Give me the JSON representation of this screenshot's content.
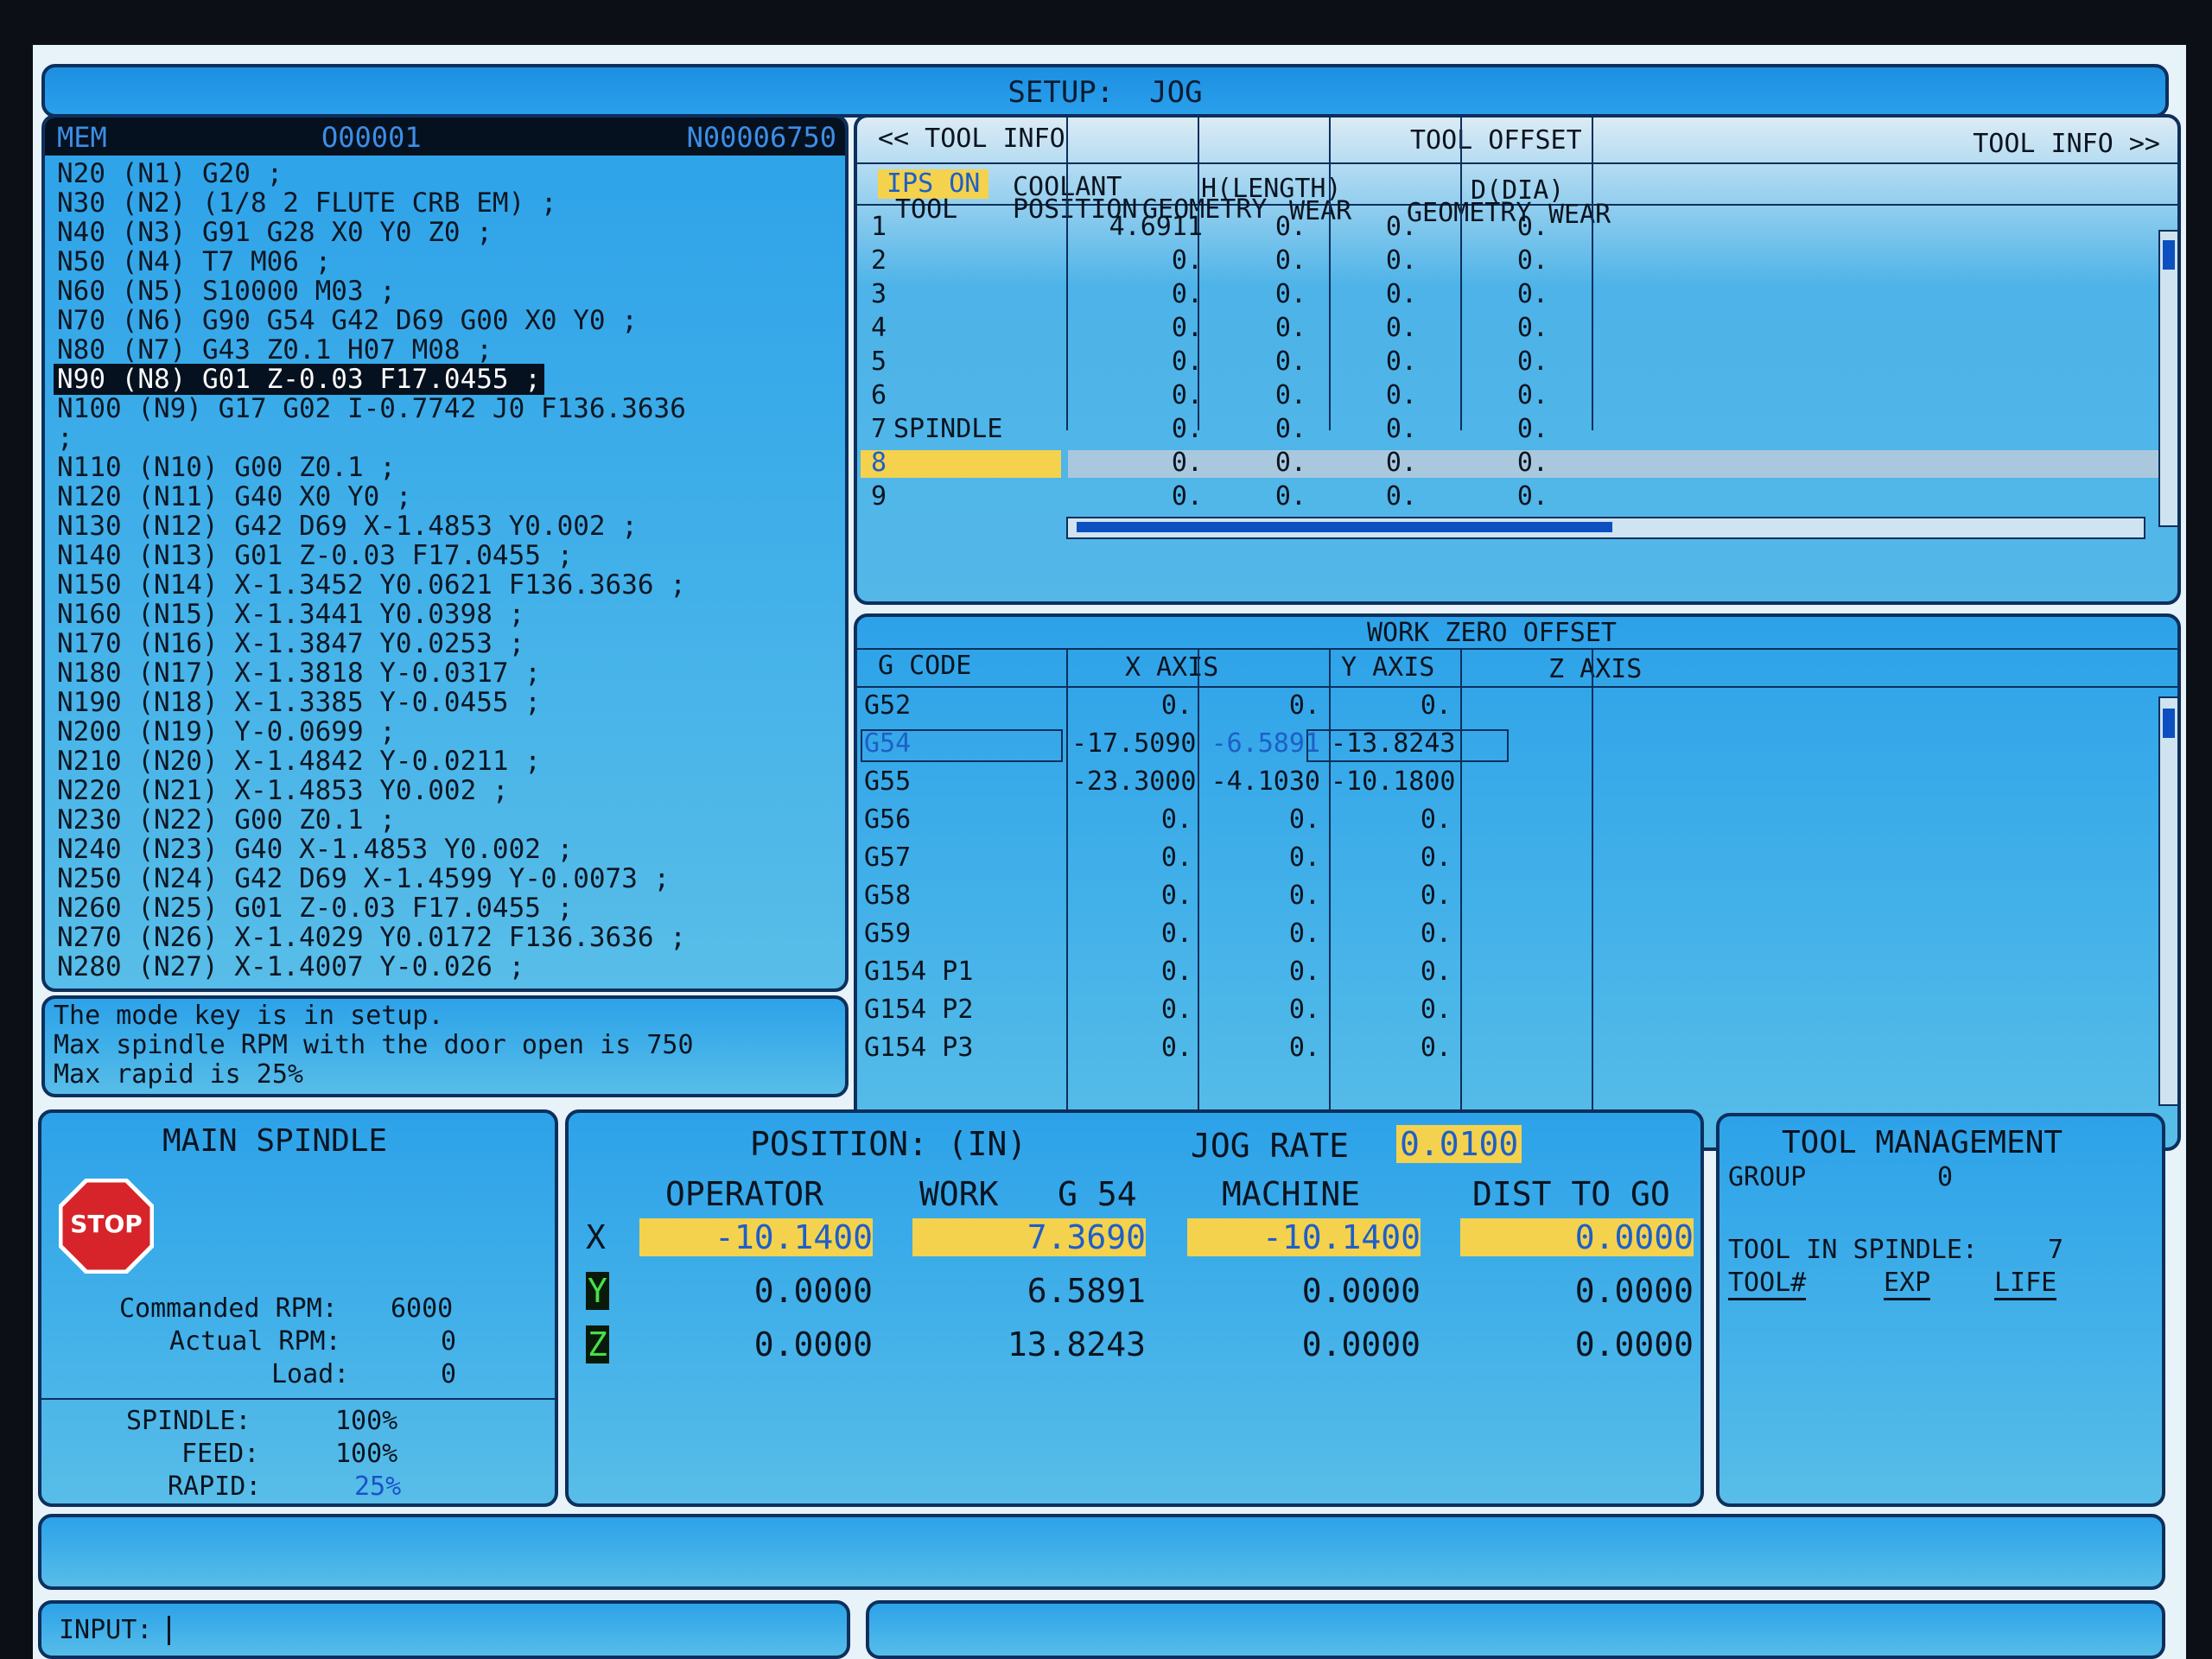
{
  "title": "SETUP:  JOG",
  "program": {
    "mode": "MEM",
    "number": "O00001",
    "seq": "N00006750",
    "lines": [
      "N20 (N1) G20 ;",
      "N30 (N2) (1/8 2 FLUTE CRB EM) ;",
      "N40 (N3) G91 G28 X0 Y0 Z0 ;",
      "N50 (N4) T7 M06 ;",
      "N60 (N5) S10000 M03 ;",
      "N70 (N6) G90 G54 G42 D69 G00 X0 Y0 ;",
      "N80 (N7) G43 Z0.1 H07 M08 ;",
      "N90 (N8) G01 Z-0.03 F17.0455 ;",
      "N100 (N9) G17 G02 I-0.7742 J0 F136.3636",
      ";",
      "N110 (N10) G00 Z0.1 ;",
      "N120 (N11) G40 X0 Y0 ;",
      "N130 (N12) G42 D69 X-1.4853 Y0.002 ;",
      "N140 (N13) G01 Z-0.03 F17.0455 ;",
      "N150 (N14) X-1.3452 Y0.0621 F136.3636 ;",
      "N160 (N15) X-1.3441 Y0.0398 ;",
      "N170 (N16) X-1.3847 Y0.0253 ;",
      "N180 (N17) X-1.3818 Y-0.0317 ;",
      "N190 (N18) X-1.3385 Y-0.0455 ;",
      "N200 (N19) Y-0.0699 ;",
      "N210 (N20) X-1.4842 Y-0.0211 ;",
      "N220 (N21) X-1.4853 Y0.002 ;",
      "N230 (N22) G00 Z0.1 ;",
      "N240 (N23) G40 X-1.4853 Y0.002 ;",
      "N250 (N24) G42 D69 X-1.4599 Y-0.0073 ;",
      "N260 (N25) G01 Z-0.03 F17.0455 ;",
      "N270 (N26) X-1.4029 Y0.0172 F136.3636 ;",
      "N280 (N27) X-1.4007 Y-0.026 ;"
    ]
  },
  "messages": [
    "The mode key is in setup.",
    "Max spindle RPM with the door open is 750",
    "Max rapid is 25%"
  ],
  "tool_offset": {
    "nav_prev": "<< TOOL INFO",
    "title": "TOOL OFFSET",
    "nav_next": "TOOL INFO >>",
    "ips": "IPS ON",
    "coolant": "COOLANT",
    "tool": "TOOL",
    "position": "POSITION",
    "h_length": "H(LENGTH)",
    "d_dia": "D(DIA)",
    "geometry": "GEOMETRY",
    "wear": "WEAR",
    "rows": [
      {
        "tool": "1",
        "note": "",
        "hgeo": "4.6911",
        "hwear": "0.",
        "dgeo": "0.",
        "dwear": "0."
      },
      {
        "tool": "2",
        "note": "",
        "hgeo": "0.",
        "hwear": "0.",
        "dgeo": "0.",
        "dwear": "0."
      },
      {
        "tool": "3",
        "note": "",
        "hgeo": "0.",
        "hwear": "0.",
        "dgeo": "0.",
        "dwear": "0."
      },
      {
        "tool": "4",
        "note": "",
        "hgeo": "0.",
        "hwear": "0.",
        "dgeo": "0.",
        "dwear": "0."
      },
      {
        "tool": "5",
        "note": "",
        "hgeo": "0.",
        "hwear": "0.",
        "dgeo": "0.",
        "dwear": "0."
      },
      {
        "tool": "6",
        "note": "",
        "hgeo": "0.",
        "hwear": "0.",
        "dgeo": "0.",
        "dwear": "0."
      },
      {
        "tool": "7",
        "note": "SPINDLE",
        "hgeo": "0.",
        "hwear": "0.",
        "dgeo": "0.",
        "dwear": "0."
      },
      {
        "tool": "8",
        "note": "",
        "hgeo": "0.",
        "hwear": "0.",
        "dgeo": "0.",
        "dwear": "0."
      },
      {
        "tool": "9",
        "note": "",
        "hgeo": "0.",
        "hwear": "0.",
        "dgeo": "0.",
        "dwear": "0."
      }
    ]
  },
  "work_zero": {
    "title": "WORK ZERO OFFSET",
    "gcode": "G CODE",
    "xaxis": "X AXIS",
    "yaxis": "Y AXIS",
    "zaxis": "Z AXIS",
    "rows": [
      {
        "g": "G52",
        "x": "0.",
        "y": "0.",
        "z": "0."
      },
      {
        "g": "G54",
        "x": "-17.5090",
        "y": "-6.5891",
        "z": "-13.8243"
      },
      {
        "g": "G55",
        "x": "-23.3000",
        "y": "-4.1030",
        "z": "-10.1800"
      },
      {
        "g": "G56",
        "x": "0.",
        "y": "0.",
        "z": "0."
      },
      {
        "g": "G57",
        "x": "0.",
        "y": "0.",
        "z": "0."
      },
      {
        "g": "G58",
        "x": "0.",
        "y": "0.",
        "z": "0."
      },
      {
        "g": "G59",
        "x": "0.",
        "y": "0.",
        "z": "0."
      },
      {
        "g": "G154 P1",
        "x": "0.",
        "y": "0.",
        "z": "0."
      },
      {
        "g": "G154 P2",
        "x": "0.",
        "y": "0.",
        "z": "0."
      },
      {
        "g": "G154 P3",
        "x": "0.",
        "y": "0.",
        "z": "0."
      }
    ]
  },
  "spindle": {
    "title": "MAIN SPINDLE",
    "stop": "STOP",
    "cmd_label": "Commanded RPM:",
    "cmd_val": "6000",
    "act_label": "Actual RPM:",
    "act_val": "0",
    "load_label": "Load:",
    "load_val": "0",
    "spindle_label": "SPINDLE:",
    "spindle_val": "100%",
    "feed_label": "FEED:",
    "feed_val": "100%",
    "rapid_label": "RAPID:",
    "rapid_val": "25%"
  },
  "position": {
    "title": "POSITION: (IN)",
    "jog_label": "JOG RATE",
    "jog_val": "0.0100",
    "cols": [
      "OPERATOR",
      "WORK   G 54",
      "MACHINE",
      "DIST TO GO"
    ],
    "axes": [
      {
        "name": "X",
        "vals": [
          "-10.1400",
          "7.3690",
          "-10.1400",
          "0.0000"
        ]
      },
      {
        "name": "Y",
        "vals": [
          "0.0000",
          "6.5891",
          "0.0000",
          "0.0000"
        ]
      },
      {
        "name": "Z",
        "vals": [
          "0.0000",
          "13.8243",
          "0.0000",
          "0.0000"
        ]
      }
    ]
  },
  "mgmt": {
    "title": "TOOL MANAGEMENT",
    "group_label": "GROUP",
    "group_val": "0",
    "spindle_label": "TOOL IN SPINDLE:",
    "spindle_val": "7",
    "toolnum": "TOOL#",
    "exp": "EXP",
    "life": "LIFE"
  },
  "input": {
    "label": "INPUT:",
    "value": ""
  }
}
